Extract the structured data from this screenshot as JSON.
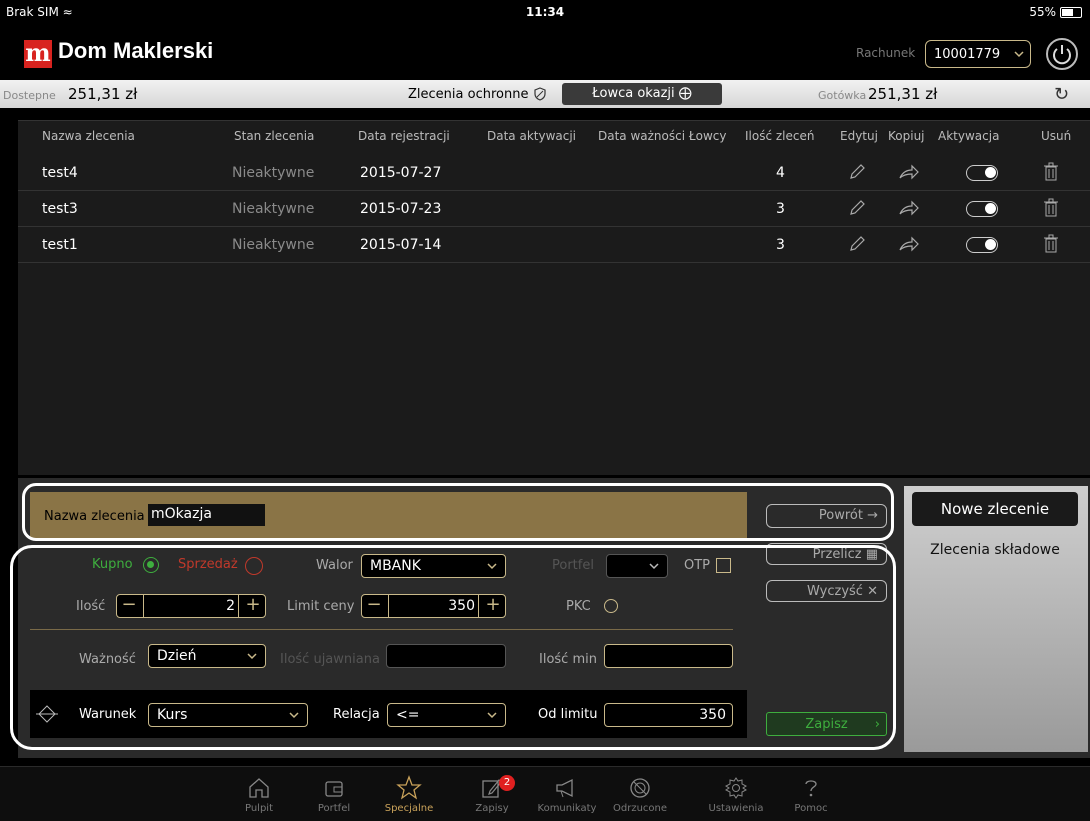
{
  "status_bar": {
    "carrier": "Brak SIM",
    "time": "11:34",
    "battery": "55%"
  },
  "header": {
    "logo_letter": "m",
    "brand": "Dom Maklerski",
    "account_label": "Rachunek",
    "account_value": "10001779"
  },
  "info_bar": {
    "available_label": "Dostepne",
    "available_value": "251,31 zł",
    "protective_orders": "Zlecenia ochronne",
    "opportunity_hunter": "Łowca okazji",
    "cash_label": "Gotówka",
    "cash_value": "251,31 zł"
  },
  "table": {
    "columns": [
      "Nazwa zlecenia",
      "Stan zlecenia",
      "Data rejestracji",
      "Data aktywacji",
      "Data ważności Łowcy",
      "Ilość zleceń",
      "Edytuj",
      "Kopiuj",
      "Aktywacja",
      "Usuń"
    ],
    "rows": [
      {
        "name": "test4",
        "state": "Nieaktywne",
        "registered": "2015-07-27",
        "activated": "",
        "valid_until": "",
        "count": "4"
      },
      {
        "name": "test3",
        "state": "Nieaktywne",
        "registered": "2015-07-23",
        "activated": "",
        "valid_until": "",
        "count": "3"
      },
      {
        "name": "test1",
        "state": "Nieaktywne",
        "registered": "2015-07-14",
        "activated": "",
        "valid_until": "",
        "count": "3"
      }
    ]
  },
  "form": {
    "name_label": "Nazwa zlecenia",
    "name_value": "mOkazja",
    "buy_label": "Kupno",
    "sell_label": "Sprzedaż",
    "walor_label": "Walor",
    "walor_value": "MBANK",
    "portfel_label": "Portfel",
    "otp_label": "OTP",
    "ilosc_label": "Ilość",
    "ilosc_value": "2",
    "limit_label": "Limit ceny",
    "limit_value": "350",
    "pkc_label": "PKC",
    "waznosc_label": "Ważność",
    "waznosc_value": "Dzień",
    "ilosc_ujawniana_label": "Ilość ujawniana",
    "ilosc_min_label": "Ilość min",
    "warunek_label": "Warunek",
    "warunek_value": "Kurs",
    "relacja_label": "Relacja",
    "relacja_value": "<=",
    "od_limitu_label": "Od limitu",
    "od_limitu_value": "350"
  },
  "actions": {
    "powrot": "Powrót",
    "przelicz": "Przelicz",
    "wyczysc": "Wyczyść",
    "zapisz": "Zapisz",
    "nowe_zlecenie": "Nowe zlecenie",
    "zlecenia_skladowe": "Zlecenia składowe"
  },
  "tabs": [
    {
      "label": "Pulpit",
      "icon": "home-icon"
    },
    {
      "label": "Portfel",
      "icon": "wallet-icon"
    },
    {
      "label": "Specjalne",
      "icon": "star-icon",
      "active": true
    },
    {
      "label": "Zapisy",
      "icon": "edit-icon",
      "badge": "2"
    },
    {
      "label": "Komunikaty",
      "icon": "megaphone-icon"
    },
    {
      "label": "Odrzucone",
      "icon": "rejected-icon"
    },
    {
      "label": "Ustawienia",
      "icon": "gear-icon"
    },
    {
      "label": "Pomoc",
      "icon": "help-icon"
    }
  ],
  "colors": {
    "brand_red": "#d8231f",
    "accent_gold": "#c9b98a",
    "buy_green": "#3eae3e",
    "sell_red": "#c0392b",
    "name_bar": "#8a7446"
  }
}
